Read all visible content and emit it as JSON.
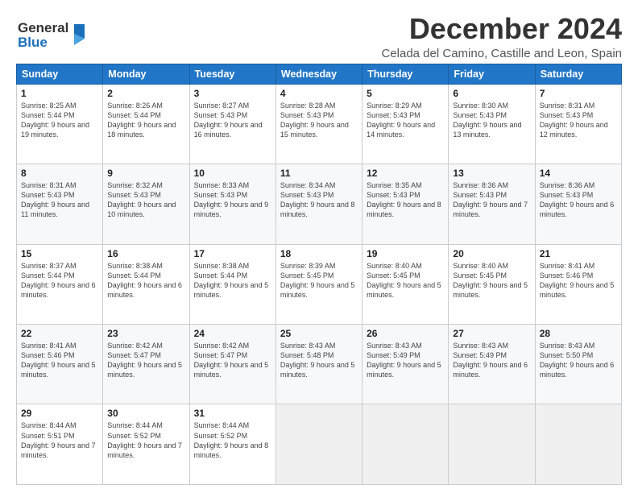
{
  "logo": {
    "line1": "General",
    "line2": "Blue",
    "icon_color": "#1a6fba"
  },
  "title": "December 2024",
  "location": "Celada del Camino, Castille and Leon, Spain",
  "headers": [
    "Sunday",
    "Monday",
    "Tuesday",
    "Wednesday",
    "Thursday",
    "Friday",
    "Saturday"
  ],
  "weeks": [
    [
      {
        "day": "1",
        "sunrise": "Sunrise: 8:25 AM",
        "sunset": "Sunset: 5:44 PM",
        "daylight": "Daylight: 9 hours and 19 minutes."
      },
      {
        "day": "2",
        "sunrise": "Sunrise: 8:26 AM",
        "sunset": "Sunset: 5:44 PM",
        "daylight": "Daylight: 9 hours and 18 minutes."
      },
      {
        "day": "3",
        "sunrise": "Sunrise: 8:27 AM",
        "sunset": "Sunset: 5:43 PM",
        "daylight": "Daylight: 9 hours and 16 minutes."
      },
      {
        "day": "4",
        "sunrise": "Sunrise: 8:28 AM",
        "sunset": "Sunset: 5:43 PM",
        "daylight": "Daylight: 9 hours and 15 minutes."
      },
      {
        "day": "5",
        "sunrise": "Sunrise: 8:29 AM",
        "sunset": "Sunset: 5:43 PM",
        "daylight": "Daylight: 9 hours and 14 minutes."
      },
      {
        "day": "6",
        "sunrise": "Sunrise: 8:30 AM",
        "sunset": "Sunset: 5:43 PM",
        "daylight": "Daylight: 9 hours and 13 minutes."
      },
      {
        "day": "7",
        "sunrise": "Sunrise: 8:31 AM",
        "sunset": "Sunset: 5:43 PM",
        "daylight": "Daylight: 9 hours and 12 minutes."
      }
    ],
    [
      {
        "day": "8",
        "sunrise": "Sunrise: 8:31 AM",
        "sunset": "Sunset: 5:43 PM",
        "daylight": "Daylight: 9 hours and 11 minutes."
      },
      {
        "day": "9",
        "sunrise": "Sunrise: 8:32 AM",
        "sunset": "Sunset: 5:43 PM",
        "daylight": "Daylight: 9 hours and 10 minutes."
      },
      {
        "day": "10",
        "sunrise": "Sunrise: 8:33 AM",
        "sunset": "Sunset: 5:43 PM",
        "daylight": "Daylight: 9 hours and 9 minutes."
      },
      {
        "day": "11",
        "sunrise": "Sunrise: 8:34 AM",
        "sunset": "Sunset: 5:43 PM",
        "daylight": "Daylight: 9 hours and 8 minutes."
      },
      {
        "day": "12",
        "sunrise": "Sunrise: 8:35 AM",
        "sunset": "Sunset: 5:43 PM",
        "daylight": "Daylight: 9 hours and 8 minutes."
      },
      {
        "day": "13",
        "sunrise": "Sunrise: 8:36 AM",
        "sunset": "Sunset: 5:43 PM",
        "daylight": "Daylight: 9 hours and 7 minutes."
      },
      {
        "day": "14",
        "sunrise": "Sunrise: 8:36 AM",
        "sunset": "Sunset: 5:43 PM",
        "daylight": "Daylight: 9 hours and 6 minutes."
      }
    ],
    [
      {
        "day": "15",
        "sunrise": "Sunrise: 8:37 AM",
        "sunset": "Sunset: 5:44 PM",
        "daylight": "Daylight: 9 hours and 6 minutes."
      },
      {
        "day": "16",
        "sunrise": "Sunrise: 8:38 AM",
        "sunset": "Sunset: 5:44 PM",
        "daylight": "Daylight: 9 hours and 6 minutes."
      },
      {
        "day": "17",
        "sunrise": "Sunrise: 8:38 AM",
        "sunset": "Sunset: 5:44 PM",
        "daylight": "Daylight: 9 hours and 5 minutes."
      },
      {
        "day": "18",
        "sunrise": "Sunrise: 8:39 AM",
        "sunset": "Sunset: 5:45 PM",
        "daylight": "Daylight: 9 hours and 5 minutes."
      },
      {
        "day": "19",
        "sunrise": "Sunrise: 8:40 AM",
        "sunset": "Sunset: 5:45 PM",
        "daylight": "Daylight: 9 hours and 5 minutes."
      },
      {
        "day": "20",
        "sunrise": "Sunrise: 8:40 AM",
        "sunset": "Sunset: 5:45 PM",
        "daylight": "Daylight: 9 hours and 5 minutes."
      },
      {
        "day": "21",
        "sunrise": "Sunrise: 8:41 AM",
        "sunset": "Sunset: 5:46 PM",
        "daylight": "Daylight: 9 hours and 5 minutes."
      }
    ],
    [
      {
        "day": "22",
        "sunrise": "Sunrise: 8:41 AM",
        "sunset": "Sunset: 5:46 PM",
        "daylight": "Daylight: 9 hours and 5 minutes."
      },
      {
        "day": "23",
        "sunrise": "Sunrise: 8:42 AM",
        "sunset": "Sunset: 5:47 PM",
        "daylight": "Daylight: 9 hours and 5 minutes."
      },
      {
        "day": "24",
        "sunrise": "Sunrise: 8:42 AM",
        "sunset": "Sunset: 5:47 PM",
        "daylight": "Daylight: 9 hours and 5 minutes."
      },
      {
        "day": "25",
        "sunrise": "Sunrise: 8:43 AM",
        "sunset": "Sunset: 5:48 PM",
        "daylight": "Daylight: 9 hours and 5 minutes."
      },
      {
        "day": "26",
        "sunrise": "Sunrise: 8:43 AM",
        "sunset": "Sunset: 5:49 PM",
        "daylight": "Daylight: 9 hours and 5 minutes."
      },
      {
        "day": "27",
        "sunrise": "Sunrise: 8:43 AM",
        "sunset": "Sunset: 5:49 PM",
        "daylight": "Daylight: 9 hours and 6 minutes."
      },
      {
        "day": "28",
        "sunrise": "Sunrise: 8:43 AM",
        "sunset": "Sunset: 5:50 PM",
        "daylight": "Daylight: 9 hours and 6 minutes."
      }
    ],
    [
      {
        "day": "29",
        "sunrise": "Sunrise: 8:44 AM",
        "sunset": "Sunset: 5:51 PM",
        "daylight": "Daylight: 9 hours and 7 minutes."
      },
      {
        "day": "30",
        "sunrise": "Sunrise: 8:44 AM",
        "sunset": "Sunset: 5:52 PM",
        "daylight": "Daylight: 9 hours and 7 minutes."
      },
      {
        "day": "31",
        "sunrise": "Sunrise: 8:44 AM",
        "sunset": "Sunset: 5:52 PM",
        "daylight": "Daylight: 9 hours and 8 minutes."
      },
      null,
      null,
      null,
      null
    ]
  ]
}
